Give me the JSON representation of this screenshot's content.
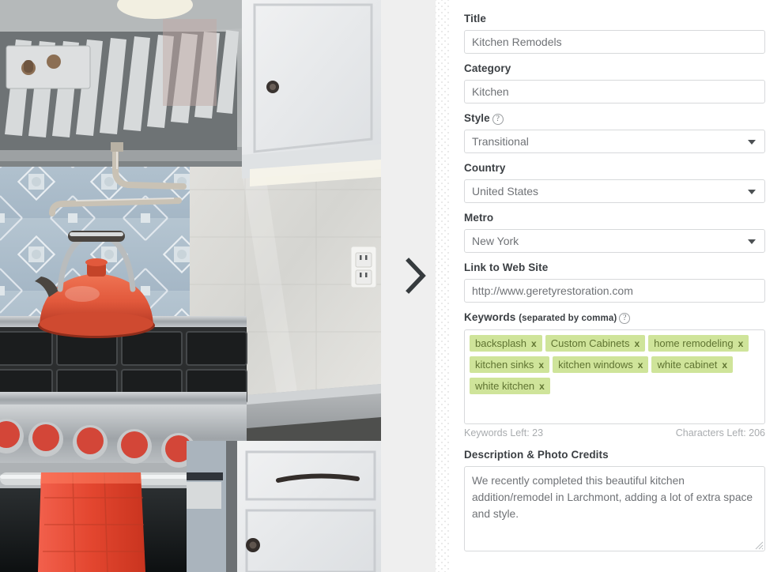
{
  "photo": {
    "alt_description": "Kitchen with stainless steel range hood, blue tile backsplash, red kettle on gas range, white cabinets with dark bronze hardware, marble backsplash and red towel on oven door",
    "colors": {
      "hood_steel": "#b9bcbd",
      "tile_blue": "#aebfcc",
      "kettle_red": "#e2593c",
      "towel_red": "#e9513f",
      "cabinet_white": "#e8eaec",
      "marble": "#dcdcd8",
      "counter_gray": "#9fa3a6",
      "knob_red": "#d34638",
      "hardware_dark": "#3a3431"
    }
  },
  "gutter": {
    "next_arrow_icon": "chevron-right-icon"
  },
  "form": {
    "title": {
      "label": "Title",
      "value": "Kitchen Remodels",
      "placeholder": "Title"
    },
    "category": {
      "label": "Category",
      "value": "Kitchen",
      "placeholder": "Category"
    },
    "style": {
      "label": "Style",
      "help_icon": "question-mark-icon",
      "value": "Transitional",
      "caret_icon": "chevron-down-icon"
    },
    "country": {
      "label": "Country",
      "value": "United States",
      "caret_icon": "chevron-down-icon"
    },
    "metro": {
      "label": "Metro",
      "value": "New York",
      "caret_icon": "chevron-down-icon"
    },
    "website": {
      "label": "Link to Web Site",
      "value": "http://www.geretyrestoration.com",
      "placeholder": "http://"
    },
    "keywords": {
      "label": "Keywords",
      "sub_label": "(separated by comma)",
      "help_icon": "question-mark-icon",
      "tags": [
        {
          "text": "backsplash",
          "remove": "x"
        },
        {
          "text": "Custom Cabinets",
          "remove": "x"
        },
        {
          "text": "home remodeling",
          "remove": "x"
        },
        {
          "text": "kitchen sinks",
          "remove": "x"
        },
        {
          "text": "kitchen windows",
          "remove": "x"
        },
        {
          "text": "white cabinet",
          "remove": "x"
        },
        {
          "text": "white kitchen",
          "remove": "x"
        }
      ],
      "keywords_left": "Keywords Left:  23",
      "characters_left": "Characters Left:  206",
      "tag_bg": "#cfe49a",
      "tag_fg": "#5f7331"
    },
    "description": {
      "label": "Description & Photo Credits",
      "value": "We recently completed this beautiful kitchen addition/remodel in Larchmont, adding a lot of extra space and style.",
      "placeholder": "Description & Photo Credits",
      "resize_handle_icon": "resize-grip-icon"
    }
  }
}
